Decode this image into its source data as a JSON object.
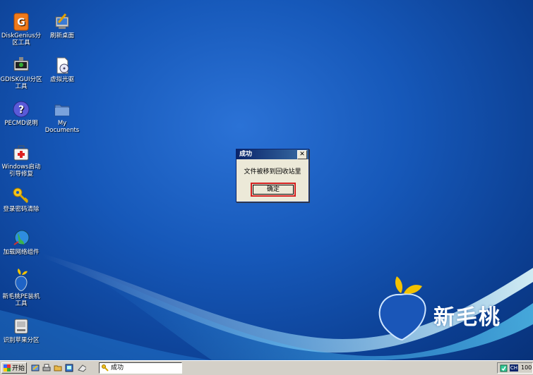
{
  "desktop": {
    "icons": [
      {
        "label": "DiskGenius分区工具",
        "icon": "diskgenius-icon"
      },
      {
        "label": "刷新桌面",
        "icon": "refresh-desktop-icon"
      },
      {
        "label": "GDISKGUI分区工具",
        "icon": "gdisk-icon"
      },
      {
        "label": "虚拟光驱",
        "icon": "virtual-drive-icon"
      },
      {
        "label": "PECMD说明",
        "icon": "help-icon"
      },
      {
        "label": "My Documents",
        "icon": "folder-icon"
      },
      {
        "label": "Windows启动引导修复",
        "icon": "boot-repair-icon"
      },
      {
        "label": "登录密码清除",
        "icon": "key-icon"
      },
      {
        "label": "加载网络组件",
        "icon": "network-globe-icon"
      },
      {
        "label": "新毛桃PE装机工具",
        "icon": "pe-install-icon"
      },
      {
        "label": "识别苹果分区",
        "icon": "apple-disk-icon"
      }
    ],
    "brand": "新毛桃"
  },
  "dialog": {
    "title": "成功",
    "message": "文件被移到回收站里",
    "ok_label": "确定"
  },
  "taskbar": {
    "start_label": "开始",
    "task_label": "成功",
    "ime": "CH",
    "clock": "100"
  }
}
